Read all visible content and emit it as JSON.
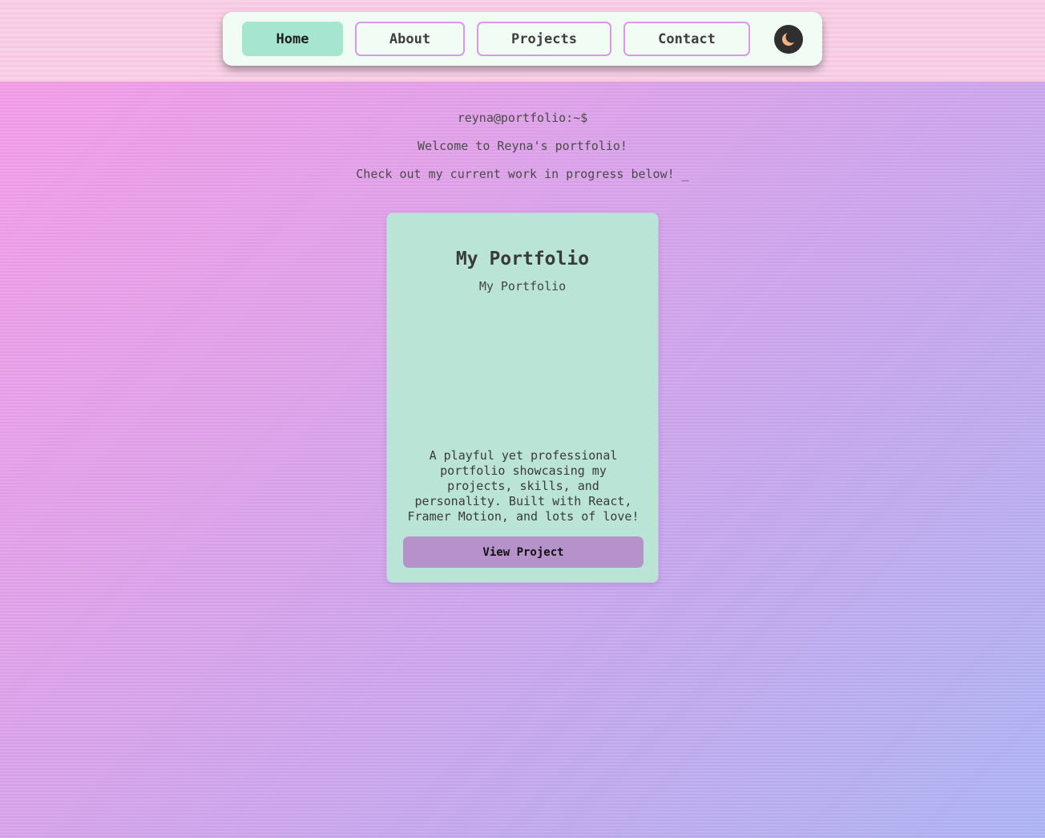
{
  "nav": {
    "items": [
      {
        "label": "Home",
        "active": true
      },
      {
        "label": "About",
        "active": false
      },
      {
        "label": "Projects",
        "active": false
      },
      {
        "label": "Contact",
        "active": false
      }
    ],
    "theme_toggle_icon": "moon-icon"
  },
  "intro": {
    "prompt": "reyna@portfolio:~$",
    "welcome": "Welcome to Reyna's portfolio!",
    "checkout": "Check out my current work in progress below! _"
  },
  "project": {
    "title": "My Portfolio",
    "subtitle": "My Portfolio",
    "description": "A playful yet professional portfolio showcasing my projects, skills, and personality. Built with React, Framer Motion, and lots of love!",
    "button_label": "View Project"
  },
  "colors": {
    "nav_background": "#f0fcf4",
    "active_tab": "#a6e6d1",
    "tab_border": "#dd97ea",
    "card_background": "#bae4d5",
    "button_background": "#b692cb",
    "toggle_background": "#2f2f2f"
  }
}
